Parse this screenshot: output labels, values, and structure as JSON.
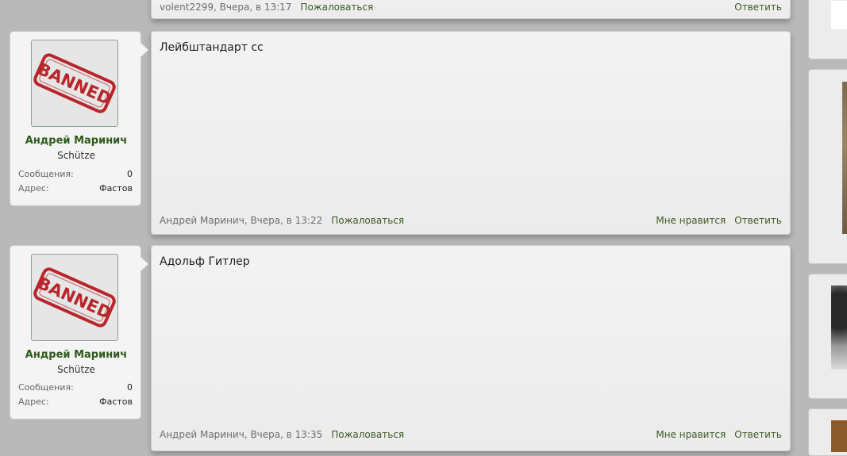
{
  "posts": [
    {
      "id": "post-top",
      "text": "",
      "footer": {
        "meta": "volent2299, Вчера, в 13:17",
        "report": "Пожаловаться",
        "like": "",
        "reply": "Ответить"
      }
    },
    {
      "id": "post-1",
      "author": {
        "name": "Андрей Маринич",
        "rank": "Schütze",
        "avatar_stamp": "BANNED",
        "stats": [
          {
            "label": "Сообщения:",
            "value": "0"
          },
          {
            "label": "Адрес:",
            "value": "Фастов"
          }
        ]
      },
      "text": "Лейбштандарт сс",
      "footer": {
        "meta": "Андрей Маринич, Вчера, в 13:22",
        "report": "Пожаловаться",
        "like": "Мне нравится",
        "reply": "Ответить"
      }
    },
    {
      "id": "post-2",
      "author": {
        "name": "Андрей Маринич",
        "rank": "Schütze",
        "avatar_stamp": "BANNED",
        "stats": [
          {
            "label": "Сообщения:",
            "value": "0"
          },
          {
            "label": "Адрес:",
            "value": "Фастов"
          }
        ]
      },
      "text": "Адольф Гитлер",
      "footer": {
        "meta": "Андрей Маринич, Вчера, в 13:35",
        "report": "Пожаловаться",
        "like": "Мне нравится",
        "reply": "Ответить"
      }
    }
  ],
  "colors": {
    "link": "#3c5a24",
    "username": "#2f5a1c",
    "stamp": "#b8262c",
    "page_bg": "#b9b9b9"
  }
}
